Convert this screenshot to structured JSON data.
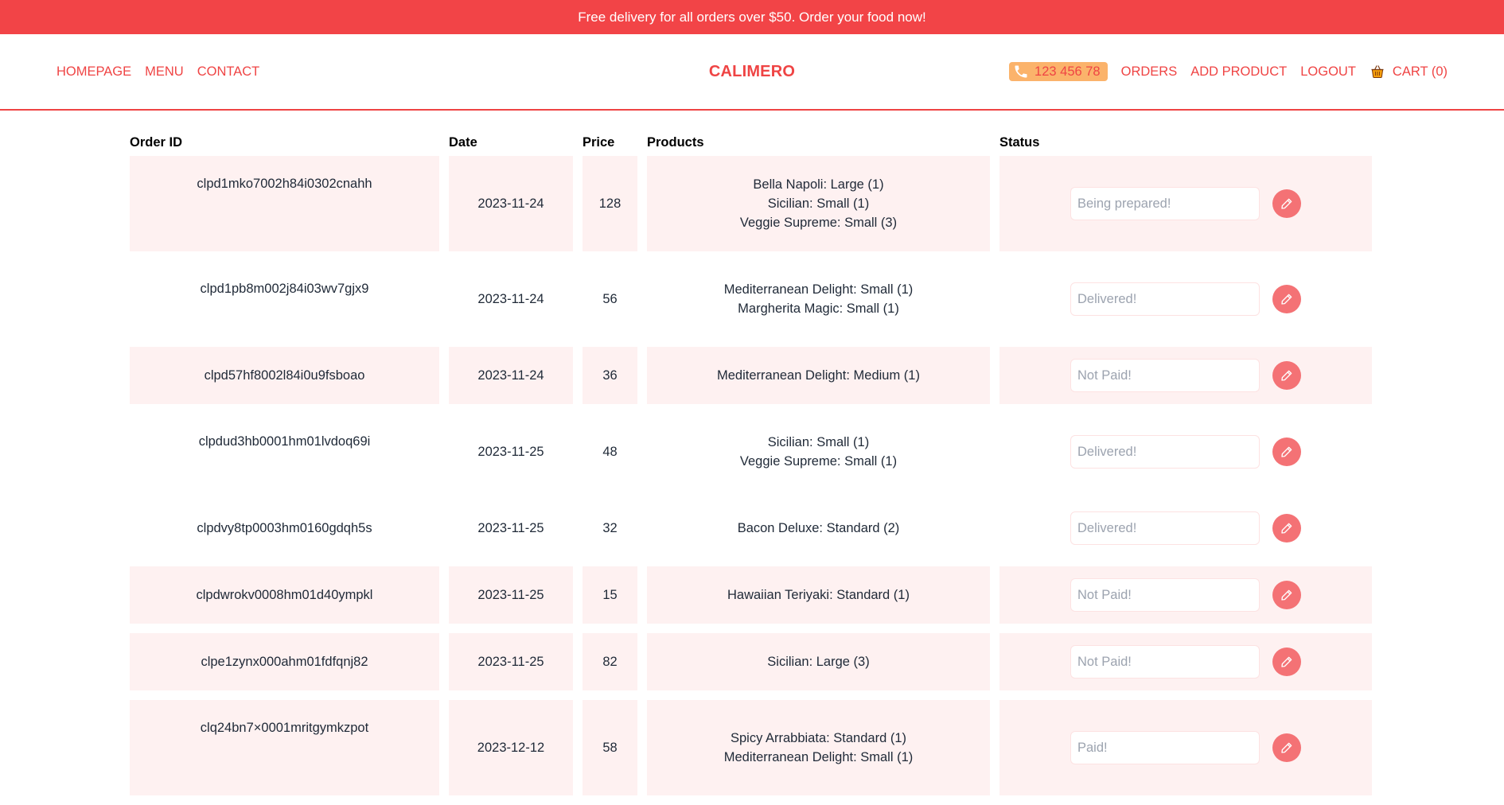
{
  "banner": {
    "text": "Free delivery for all orders over $50. Order your food now!"
  },
  "nav": {
    "left": [
      "HOMEPAGE",
      "MENU",
      "CONTACT"
    ],
    "brand": "CALIMERO",
    "phone": "123 456 78",
    "right": [
      "ORDERS",
      "ADD PRODUCT",
      "LOGOUT"
    ],
    "cart": "CART (0)"
  },
  "table": {
    "headers": {
      "id": "Order ID",
      "date": "Date",
      "price": "Price",
      "products": "Products",
      "status": "Status"
    },
    "rows": [
      {
        "id": "clpd1mko7002h84i0302cnahh",
        "date": "2023-11-24",
        "price": "128",
        "products": [
          "Bella Napoli: Large (1)",
          "Sicilian: Small (1)",
          "Veggie Supreme: Small (3)"
        ],
        "status_placeholder": "Being prepared!"
      },
      {
        "id": "clpd1pb8m002j84i03wv7gjx9",
        "date": "2023-11-24",
        "price": "56",
        "products": [
          "Mediterranean Delight: Small (1)",
          "Margherita Magic: Small (1)"
        ],
        "status_placeholder": "Delivered!"
      },
      {
        "id": "clpd57hf8002l84i0u9fsboao",
        "date": "2023-11-24",
        "price": "36",
        "products": [
          "Mediterranean Delight: Medium (1)"
        ],
        "status_placeholder": "Not Paid!"
      },
      {
        "id": "clpdud3hb0001hm01lvdoq69i",
        "date": "2023-11-25",
        "price": "48",
        "products": [
          "Sicilian: Small (1)",
          "Veggie Supreme: Small (1)"
        ],
        "status_placeholder": "Delivered!"
      },
      {
        "id": "clpdvy8tp0003hm0160gdqh5s",
        "date": "2023-11-25",
        "price": "32",
        "products": [
          "Bacon Deluxe: Standard (2)"
        ],
        "status_placeholder": "Delivered!"
      },
      {
        "id": "clpdwrokv0008hm01d40ympkl",
        "date": "2023-11-25",
        "price": "15",
        "products": [
          "Hawaiian Teriyaki: Standard (1)"
        ],
        "status_placeholder": "Not Paid!"
      },
      {
        "id": "clpe1zynx000ahm01fdfqnj82",
        "date": "2023-11-25",
        "price": "82",
        "products": [
          "Sicilian: Large (3)"
        ],
        "status_placeholder": "Not Paid!"
      },
      {
        "id": "clq24bn7×0001mritgymkzpot",
        "date": "2023-12-12",
        "price": "58",
        "products": [
          "Spicy Arrabbiata: Standard (1)",
          "Mediterranean Delight: Small (1)"
        ],
        "status_placeholder": "Paid!"
      }
    ]
  },
  "colors": {
    "accent": "#ef4444",
    "banner": "#f24447",
    "row_shade": "#fef1f1",
    "phone_chip": "#fbb36b",
    "edit_button": "#f47275"
  },
  "icons": {
    "phone": "phone-icon",
    "cart": "shopping-basket-icon",
    "edit": "pencil-icon"
  }
}
